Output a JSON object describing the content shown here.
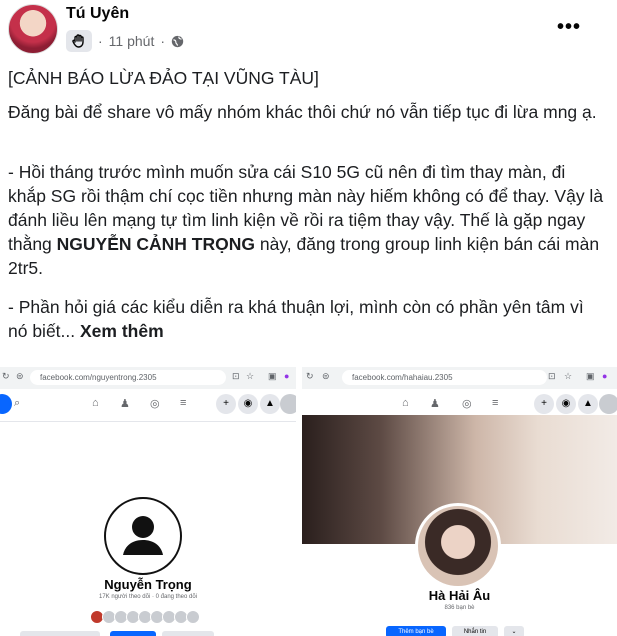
{
  "post": {
    "author": "Tú Uyên",
    "time": "11 phút",
    "dot": "·",
    "more": "•••",
    "title": "[CẢNH BÁO LỪA ĐẢO TẠI VŨNG TÀU]",
    "p1": "Đăng bài để share vô mấy nhóm khác thôi chứ nó vẫn tiếp tục đi lừa mng ạ.",
    "p2_a": "- Hồi tháng trước mình muốn sửa cái S10 5G cũ nên đi tìm thay màn, đi khắp SG rồi thậm chí cọc tiền nhưng màn này hiếm không có để thay. Vậy là đánh liều lên mạng tự tìm linh kiện về rồi ra tiệm thay vậy. Thế là gặp ngay thằng ",
    "p2_bold": "NGUYỄN CẢNH TRỌNG",
    "p2_b": " này, đăng trong group linh kiện bán cái màn 2tr5.",
    "p3": "- Phần hỏi giá các kiểu diễn ra khá thuận lợi, mình còn có phần yên tâm vì nó biết... ",
    "see_more": "Xem thêm"
  },
  "shot_left": {
    "url": "facebook.com/nguyentrong.2305",
    "name": "Nguyễn Trọng",
    "sub": "17K người theo dõi · 0 đang theo dõi"
  },
  "shot_right": {
    "url": "facebook.com/hahaiau.2305",
    "name": "Hà Hải Âu",
    "sub": "836 bạn bè",
    "add_friend": "Thêm bạn bè",
    "message": "Nhắn tin"
  },
  "colors": {
    "accent": "#0866ff",
    "meta": "#65676b"
  },
  "icons": [
    "avatar",
    "hand-badge-icon",
    "globe-icon",
    "more-icon",
    "home-icon",
    "friends-icon",
    "groups-icon",
    "menu-icon",
    "search-icon",
    "plus-icon",
    "messenger-icon",
    "bell-icon"
  ]
}
